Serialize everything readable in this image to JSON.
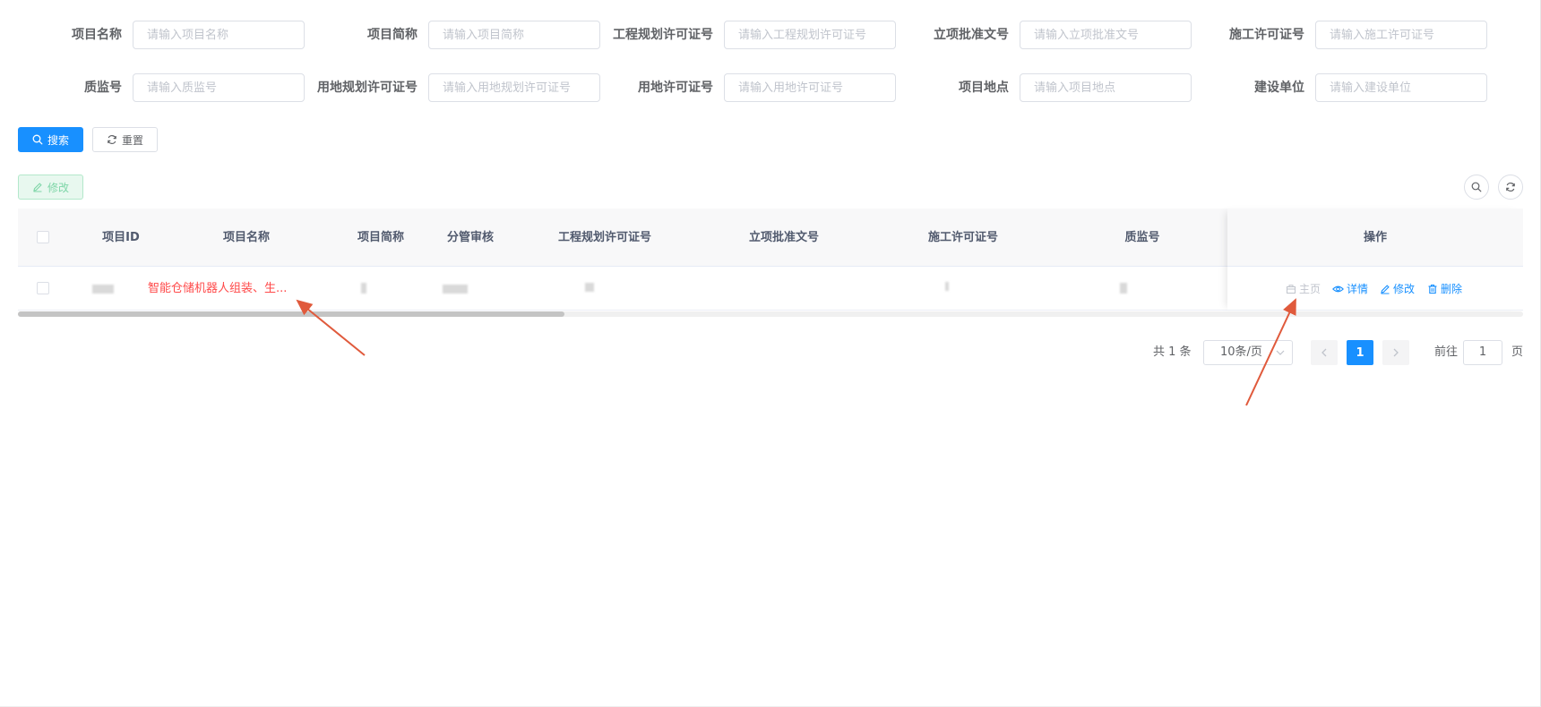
{
  "search_form": {
    "fields": [
      {
        "label": "项目名称",
        "placeholder": "请输入项目名称"
      },
      {
        "label": "项目简称",
        "placeholder": "请输入项目简称"
      },
      {
        "label": "工程规划许可证号",
        "placeholder": "请输入工程规划许可证号"
      },
      {
        "label": "立项批准文号",
        "placeholder": "请输入立项批准文号"
      },
      {
        "label": "施工许可证号",
        "placeholder": "请输入施工许可证号"
      },
      {
        "label": "质监号",
        "placeholder": "请输入质监号"
      },
      {
        "label": "用地规划许可证号",
        "placeholder": "请输入用地规划许可证号"
      },
      {
        "label": "用地许可证号",
        "placeholder": "请输入用地许可证号"
      },
      {
        "label": "项目地点",
        "placeholder": "请输入项目地点"
      },
      {
        "label": "建设单位",
        "placeholder": "请输入建设单位"
      }
    ],
    "search_label": "搜索",
    "reset_label": "重置"
  },
  "toolbar": {
    "edit_label": "修改"
  },
  "table": {
    "headers": [
      "项目ID",
      "项目名称",
      "项目简称",
      "分管审核",
      "工程规划许可证号",
      "立项批准文号",
      "施工许可证号",
      "质监号",
      "操作"
    ],
    "rows": [
      {
        "name": "智能仓储机器人组装、生..."
      }
    ],
    "actions": {
      "home": "主页",
      "detail": "详情",
      "edit": "修改",
      "delete": "删除"
    }
  },
  "pagination": {
    "total_text": "共 1 条",
    "page_size": "10条/页",
    "current_page": "1",
    "goto_prefix": "前往",
    "goto_value": "1",
    "goto_suffix": "页"
  },
  "colors": {
    "primary": "#1890ff",
    "link_red": "#ff4949",
    "annotation_arrow": "#e05a3c"
  }
}
